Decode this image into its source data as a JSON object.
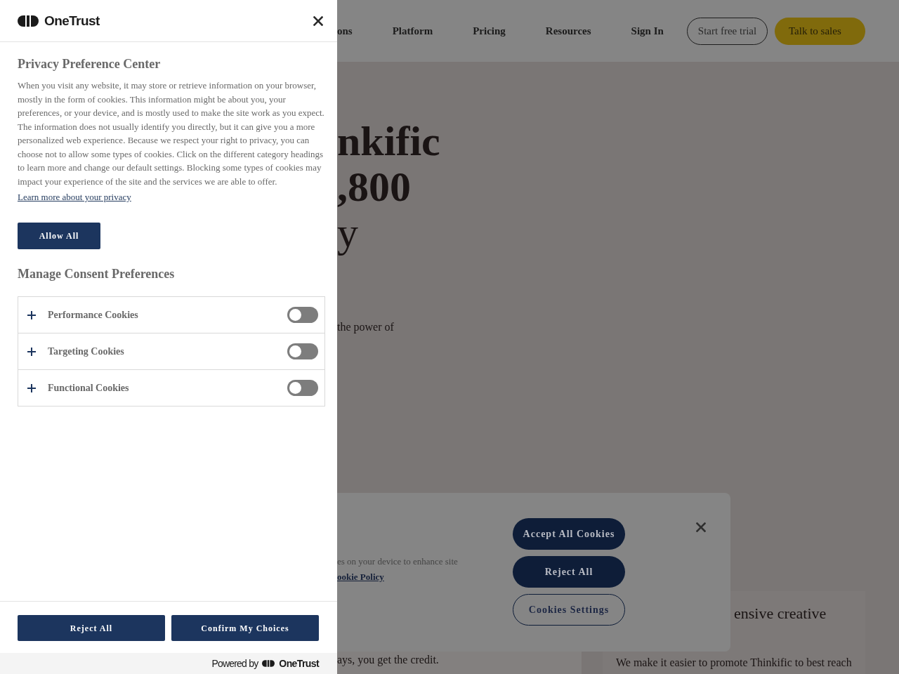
{
  "preference_center": {
    "logo": {
      "text": "OneTrust"
    },
    "title": "Privacy Preference Center",
    "description": "When you visit any website, it may store or retrieve information on your browser, mostly in the form of cookies. This information might be about you, your preferences, or your device, and is mostly used to make the site work as you expect. The information does not usually identify you directly, but it can give you a more personalized web experience. Because we respect your right to privacy, you can choose not to allow some types of cookies. Click on the different category headings to learn more and change our default settings. Blocking some types of cookies may impact your experience of the site and the services we are able to offer.",
    "privacy_link": "Learn more about your privacy",
    "allow_all_button": "Allow All",
    "consent_heading": "Manage Consent Preferences",
    "cookie_categories": [
      {
        "label": "Performance Cookies",
        "expanded": false,
        "on": false
      },
      {
        "label": "Targeting Cookies",
        "expanded": false,
        "on": false
      },
      {
        "label": "Functional Cookies",
        "expanded": false,
        "on": false
      }
    ],
    "footer_buttons": [
      "Reject All",
      "Confirm My Choices"
    ],
    "powered_by": {
      "text": "Powered by",
      "brand": "OneTrust"
    }
  },
  "background_site": {
    "nav_links": [
      "ons",
      "Platform",
      "Pricing",
      "Resources",
      "Sign In"
    ],
    "nav_buttons": [
      {
        "label": "Start free trial",
        "kind": "outline"
      },
      {
        "label": "Talk to sales",
        "kind": "filled"
      }
    ],
    "hero_lines": [
      "nkific",
      ",800",
      "y"
    ],
    "hero_text": "the power of",
    "cards": [
      {
        "text": "ays, you get the credit."
      },
      {
        "heading": "ensive creative",
        "text": "We make it easier to promote Thinkific to best reach"
      }
    ]
  },
  "cookie_banner": {
    "text": "es on your device to enhance site",
    "policy_link": "ookie Policy",
    "buttons": [
      {
        "label": "Accept All Cookies",
        "kind": "filled"
      },
      {
        "label": "Reject All",
        "kind": "filled"
      },
      {
        "label": "Cookies Settings",
        "kind": "outline"
      }
    ]
  }
}
